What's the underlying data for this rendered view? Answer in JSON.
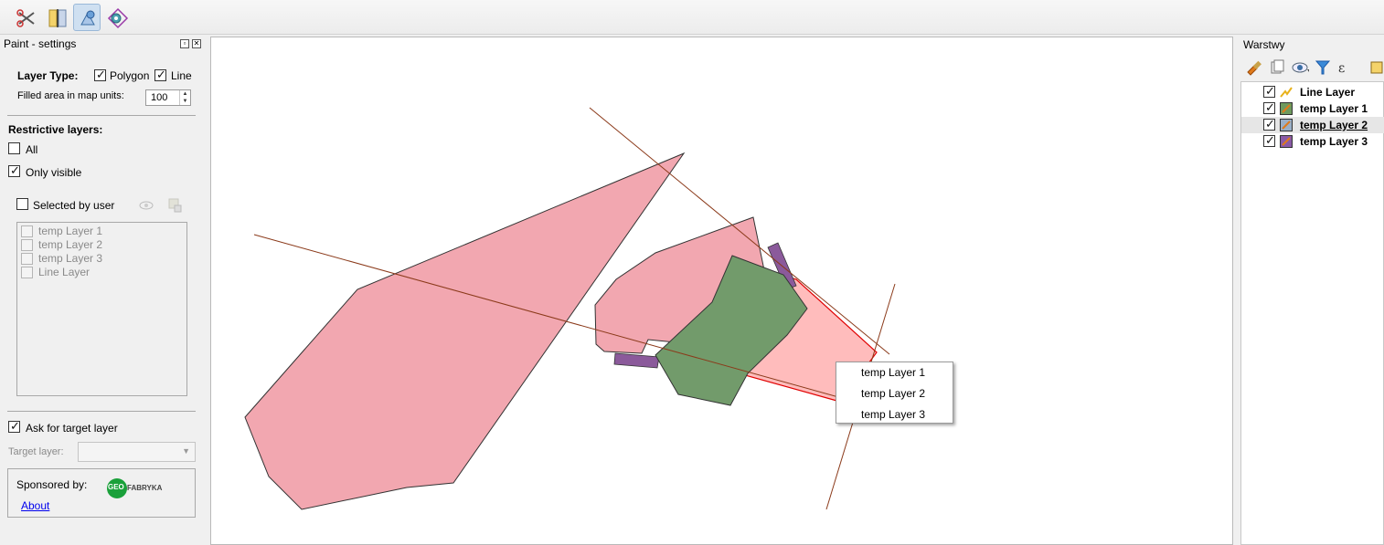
{
  "toolbar": {
    "buttons": [
      {
        "name": "split-features-icon",
        "active": false
      },
      {
        "name": "vertex-tool-icon",
        "active": false
      },
      {
        "name": "paint-tool-icon",
        "active": true
      },
      {
        "name": "node-tool-icon",
        "active": false
      }
    ]
  },
  "left_panel": {
    "title": "Paint - settings",
    "layer_type_label": "Layer Type:",
    "polygon_label": "Polygon",
    "polygon_checked": true,
    "line_label": "Line",
    "line_checked": true,
    "filled_area_label": "Filled area in map units:",
    "filled_area_value": "100",
    "restrictive_label": "Restrictive layers:",
    "all_label": "All",
    "all_checked": false,
    "only_visible_label": "Only visible",
    "only_visible_checked": true,
    "selected_by_user_label": "Selected by user",
    "selected_by_user_checked": false,
    "layer_list": [
      "temp Layer 1",
      "temp Layer 2",
      "temp Layer 3",
      "Line Layer"
    ],
    "ask_target_label": "Ask for target layer",
    "ask_target_checked": true,
    "target_layer_label": "Target layer:",
    "target_layer_value": "",
    "sponsored_label": "Sponsored by:",
    "about_label": "About",
    "logo_text_geo": "GEO",
    "logo_text_fabryka": "FABRYKA"
  },
  "context_menu": {
    "items": [
      "temp Layer 1",
      "temp Layer 2",
      "temp Layer 3"
    ]
  },
  "right_panel": {
    "title": "Warstwy",
    "layers": [
      {
        "name": "Line Layer",
        "checked": true,
        "type": "line",
        "color": "#f2c21b",
        "selected": false
      },
      {
        "name": "temp Layer 1",
        "checked": true,
        "type": "polygon",
        "color": "#6f9a5e",
        "selected": false
      },
      {
        "name": "temp Layer 2",
        "checked": true,
        "type": "polygon",
        "color": "#9ab0c8",
        "selected": true
      },
      {
        "name": "temp Layer 3",
        "checked": true,
        "type": "polygon",
        "color": "#8a5aa6",
        "selected": false
      }
    ]
  },
  "colors": {
    "pink_fill": "#f2a7b0",
    "light_pink_fill": "#ffbcbc",
    "green_fill": "#729b6b",
    "purple_fill": "#8b5a9b",
    "line_color": "#8b3a1a",
    "selection_red": "#e00000"
  }
}
